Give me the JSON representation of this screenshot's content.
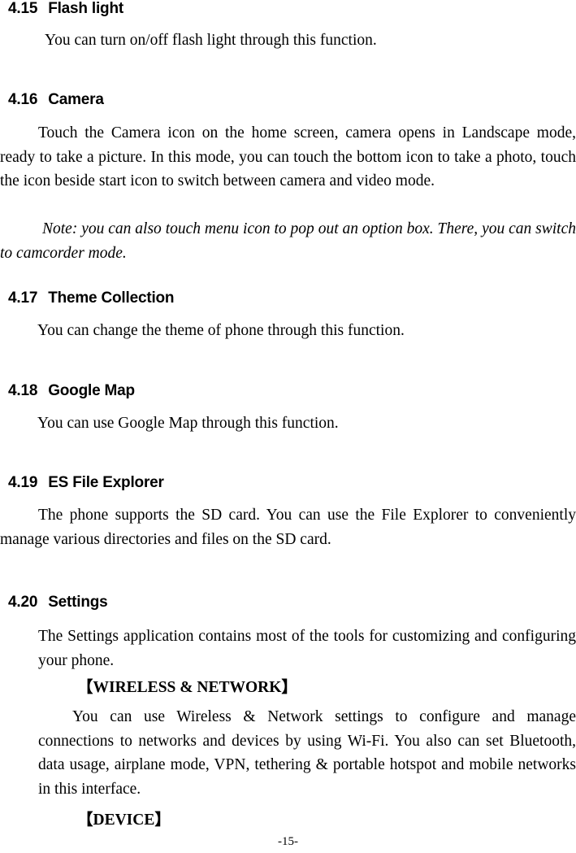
{
  "document": {
    "page_number": "-15-",
    "sections": [
      {
        "number": "4.15",
        "title": "Flash light",
        "paragraphs": [
          "You can turn on/off flash light through this function."
        ]
      },
      {
        "number": "4.16",
        "title": "Camera",
        "paragraphs": [
          "Touch the Camera icon on the home screen, camera opens in Landscape mode, ready to take a picture. In this mode, you can touch the bottom icon to take a photo, touch the icon beside start icon to switch between camera and video mode.",
          "Note: you can also touch menu icon to pop out an option box. There, you can switch to camcorder mode."
        ]
      },
      {
        "number": "4.17",
        "title": "Theme Collection",
        "paragraphs": [
          "You can change the theme of phone through this function."
        ]
      },
      {
        "number": "4.18",
        "title": "Google Map",
        "paragraphs": [
          "You can use Google Map through this function."
        ]
      },
      {
        "number": "4.19",
        "title": "ES File Explorer",
        "paragraphs": [
          "The phone supports the SD card. You can use the File Explorer to conveniently manage various directories and files on the SD card."
        ]
      },
      {
        "number": "4.20",
        "title": "Settings",
        "paragraphs": [
          "The Settings application contains most of the tools for customizing and configuring your phone."
        ],
        "subsections": [
          {
            "heading": "【WIRELESS & NETWORK】",
            "body": "You can use Wireless & Network settings to configure and manage connections to networks and devices by using Wi-Fi. You also can set Bluetooth, data usage, airplane mode, VPN, tethering & portable hotspot and mobile networks in this interface."
          },
          {
            "heading": "【DEVICE】",
            "body": ""
          }
        ]
      }
    ]
  }
}
